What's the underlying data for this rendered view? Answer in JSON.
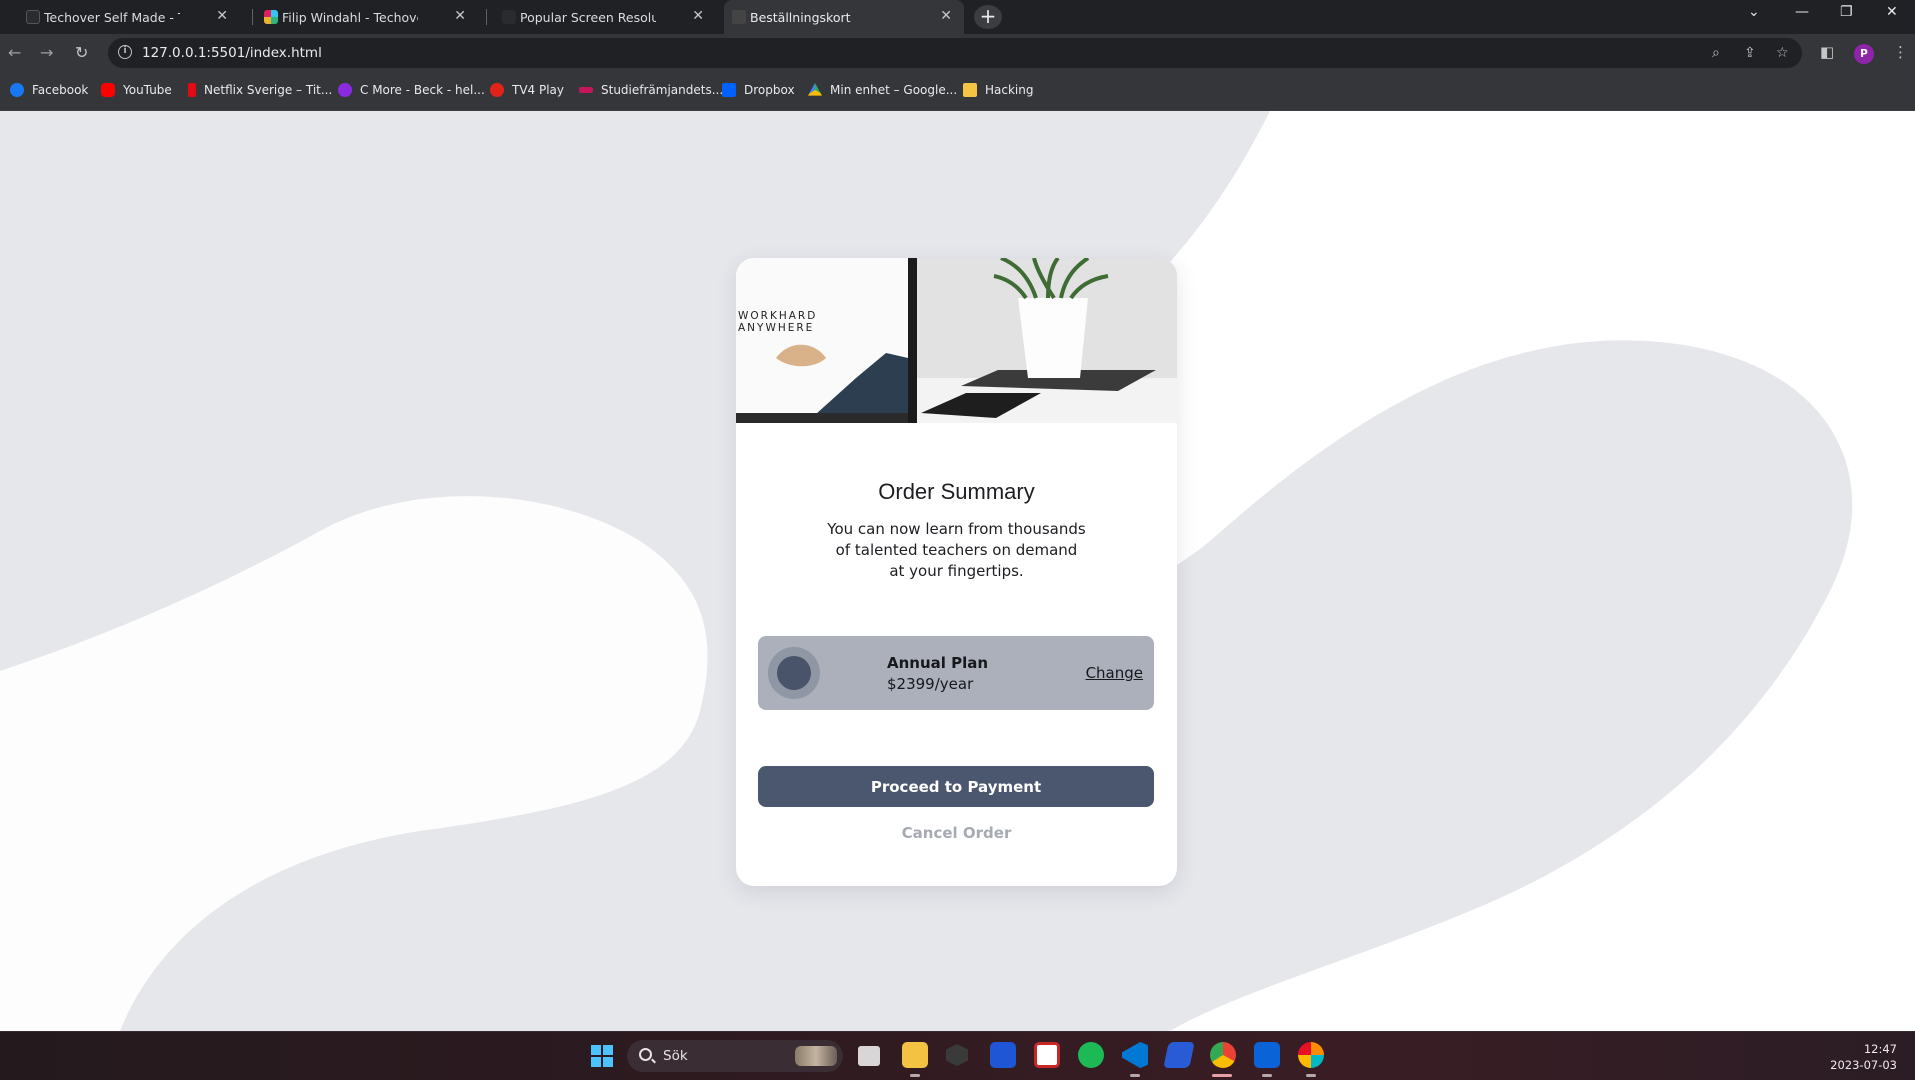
{
  "browser": {
    "tabs": [
      {
        "title": "Techover Self Made - Techover",
        "active": false
      },
      {
        "title": "Filip Windahl - Techover Academy",
        "active": false
      },
      {
        "title": "Popular Screen Resolutions | Media",
        "active": false
      },
      {
        "title": "Beställningskort",
        "active": true
      }
    ],
    "url": "127.0.0.1:5501/index.html",
    "profile_initial": "P"
  },
  "bookmarks": [
    {
      "label": "Facebook",
      "color": "#1877f2"
    },
    {
      "label": "YouTube",
      "color": "#ff0000"
    },
    {
      "label": "Netflix Sverige – Tit...",
      "color": "#e50914"
    },
    {
      "label": "C More - Beck - hel...",
      "color": "#8a2be2"
    },
    {
      "label": "TV4 Play",
      "color": "#e2231a"
    },
    {
      "label": "Studiefrämjandets...",
      "color": "#c2185b"
    },
    {
      "label": "Dropbox",
      "color": "#0061ff"
    },
    {
      "label": "Min enhet – Google...",
      "color": "#34a853"
    },
    {
      "label": "Hacking",
      "color": "#f6c445"
    }
  ],
  "card": {
    "hero_text_line1": "WORKHARD",
    "hero_text_line2": "ANYWHERE",
    "title": "Order Summary",
    "description": "You can now learn from thousands of talented teachers on demand at your fingertips.",
    "plan_name": "Annual Plan",
    "plan_price": "$2399/year",
    "change_label": "Change",
    "proceed_label": "Proceed to Payment",
    "cancel_label": "Cancel Order"
  },
  "taskbar": {
    "search_label": "Sök",
    "time": "12:47",
    "date": "2023-07-03"
  },
  "colors": {
    "page_bg": "#e6e7eb",
    "plan_bg": "#abb0bb",
    "button_bg": "#4b566f",
    "cancel_text": "#a6aab3"
  }
}
